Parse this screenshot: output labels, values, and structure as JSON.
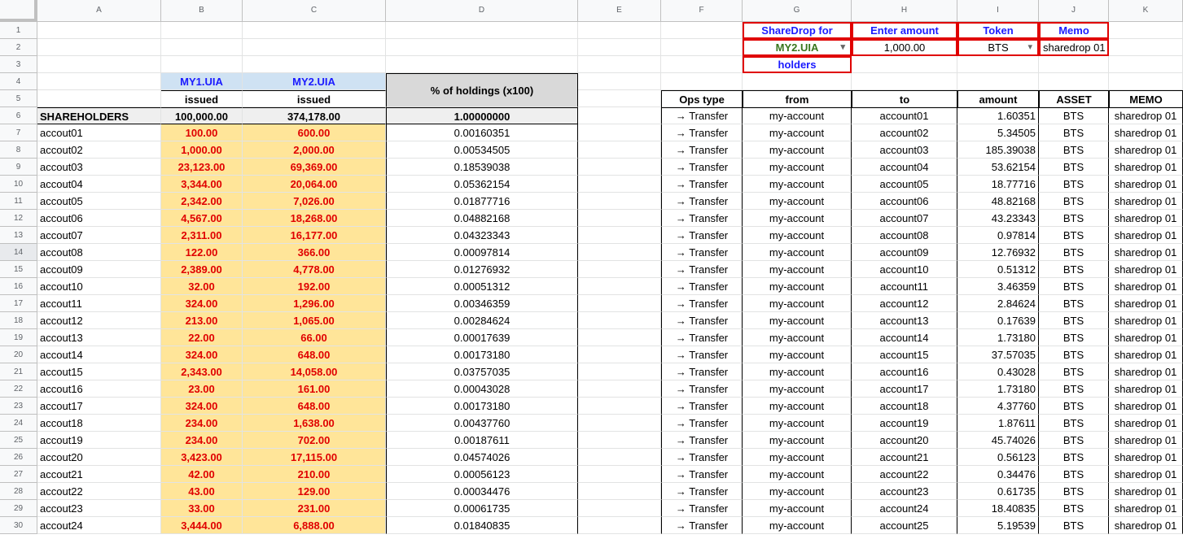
{
  "columns": [
    "A",
    "B",
    "C",
    "D",
    "E",
    "F",
    "G",
    "H",
    "I",
    "J",
    "K"
  ],
  "rows": [
    "1",
    "2",
    "3",
    "4",
    "5",
    "6",
    "7",
    "8",
    "9",
    "10",
    "11",
    "12",
    "13",
    "14",
    "15",
    "16",
    "17",
    "18",
    "19",
    "20",
    "21",
    "22",
    "23",
    "24",
    "25",
    "26",
    "27",
    "28",
    "29",
    "30"
  ],
  "left_table": {
    "asset_headers": [
      "MY1.UIA",
      "MY2.UIA"
    ],
    "issued_label": "issued",
    "pct_header": "% of holdings (x100)",
    "total_label": "SHAREHOLDERS",
    "totals": [
      "100,000.00",
      "374,178.00",
      "1.00000000"
    ],
    "rows": [
      [
        "accout01",
        "100.00",
        "600.00",
        "0.00160351"
      ],
      [
        "accout02",
        "1,000.00",
        "2,000.00",
        "0.00534505"
      ],
      [
        "accout03",
        "23,123.00",
        "69,369.00",
        "0.18539038"
      ],
      [
        "accout04",
        "3,344.00",
        "20,064.00",
        "0.05362154"
      ],
      [
        "accout05",
        "2,342.00",
        "7,026.00",
        "0.01877716"
      ],
      [
        "accout06",
        "4,567.00",
        "18,268.00",
        "0.04882168"
      ],
      [
        "accout07",
        "2,311.00",
        "16,177.00",
        "0.04323343"
      ],
      [
        "accout08",
        "122.00",
        "366.00",
        "0.00097814"
      ],
      [
        "accout09",
        "2,389.00",
        "4,778.00",
        "0.01276932"
      ],
      [
        "accout10",
        "32.00",
        "192.00",
        "0.00051312"
      ],
      [
        "accout11",
        "324.00",
        "1,296.00",
        "0.00346359"
      ],
      [
        "accout12",
        "213.00",
        "1,065.00",
        "0.00284624"
      ],
      [
        "accout13",
        "22.00",
        "66.00",
        "0.00017639"
      ],
      [
        "accout14",
        "324.00",
        "648.00",
        "0.00173180"
      ],
      [
        "accout15",
        "2,343.00",
        "14,058.00",
        "0.03757035"
      ],
      [
        "accout16",
        "23.00",
        "161.00",
        "0.00043028"
      ],
      [
        "accout17",
        "324.00",
        "648.00",
        "0.00173180"
      ],
      [
        "accout18",
        "234.00",
        "1,638.00",
        "0.00437760"
      ],
      [
        "accout19",
        "234.00",
        "702.00",
        "0.00187611"
      ],
      [
        "accout20",
        "3,423.00",
        "17,115.00",
        "0.04574026"
      ],
      [
        "accout21",
        "42.00",
        "210.00",
        "0.00056123"
      ],
      [
        "accout22",
        "43.00",
        "129.00",
        "0.00034476"
      ],
      [
        "accout23",
        "33.00",
        "231.00",
        "0.00061735"
      ],
      [
        "accout24",
        "3,444.00",
        "6,888.00",
        "0.01840835"
      ]
    ]
  },
  "controls": {
    "sharedrop_label": "ShareDrop for",
    "sharedrop_value": "MY2.UIA",
    "holders_label": "holders",
    "amount_label": "Enter amount",
    "amount_value": "1,000.00",
    "token_label": "Token",
    "token_value": "BTS",
    "memo_label": "Memo",
    "memo_value": "sharedrop 01"
  },
  "ops_table": {
    "headers": [
      "Ops type",
      "from",
      "to",
      "amount",
      "ASSET",
      "MEMO"
    ],
    "rows": [
      [
        "→ Transfer",
        "my-account",
        "account01",
        "1.60351",
        "BTS",
        "sharedrop 01"
      ],
      [
        "→ Transfer",
        "my-account",
        "account02",
        "5.34505",
        "BTS",
        "sharedrop 01"
      ],
      [
        "→ Transfer",
        "my-account",
        "account03",
        "185.39038",
        "BTS",
        "sharedrop 01"
      ],
      [
        "→ Transfer",
        "my-account",
        "account04",
        "53.62154",
        "BTS",
        "sharedrop 01"
      ],
      [
        "→ Transfer",
        "my-account",
        "account05",
        "18.77716",
        "BTS",
        "sharedrop 01"
      ],
      [
        "→ Transfer",
        "my-account",
        "account06",
        "48.82168",
        "BTS",
        "sharedrop 01"
      ],
      [
        "→ Transfer",
        "my-account",
        "account07",
        "43.23343",
        "BTS",
        "sharedrop 01"
      ],
      [
        "→ Transfer",
        "my-account",
        "account08",
        "0.97814",
        "BTS",
        "sharedrop 01"
      ],
      [
        "→ Transfer",
        "my-account",
        "account09",
        "12.76932",
        "BTS",
        "sharedrop 01"
      ],
      [
        "→ Transfer",
        "my-account",
        "account10",
        "0.51312",
        "BTS",
        "sharedrop 01"
      ],
      [
        "→ Transfer",
        "my-account",
        "account11",
        "3.46359",
        "BTS",
        "sharedrop 01"
      ],
      [
        "→ Transfer",
        "my-account",
        "account12",
        "2.84624",
        "BTS",
        "sharedrop 01"
      ],
      [
        "→ Transfer",
        "my-account",
        "account13",
        "0.17639",
        "BTS",
        "sharedrop 01"
      ],
      [
        "→ Transfer",
        "my-account",
        "account14",
        "1.73180",
        "BTS",
        "sharedrop 01"
      ],
      [
        "→ Transfer",
        "my-account",
        "account15",
        "37.57035",
        "BTS",
        "sharedrop 01"
      ],
      [
        "→ Transfer",
        "my-account",
        "account16",
        "0.43028",
        "BTS",
        "sharedrop 01"
      ],
      [
        "→ Transfer",
        "my-account",
        "account17",
        "1.73180",
        "BTS",
        "sharedrop 01"
      ],
      [
        "→ Transfer",
        "my-account",
        "account18",
        "4.37760",
        "BTS",
        "sharedrop 01"
      ],
      [
        "→ Transfer",
        "my-account",
        "account19",
        "1.87611",
        "BTS",
        "sharedrop 01"
      ],
      [
        "→ Transfer",
        "my-account",
        "account20",
        "45.74026",
        "BTS",
        "sharedrop 01"
      ],
      [
        "→ Transfer",
        "my-account",
        "account21",
        "0.56123",
        "BTS",
        "sharedrop 01"
      ],
      [
        "→ Transfer",
        "my-account",
        "account22",
        "0.34476",
        "BTS",
        "sharedrop 01"
      ],
      [
        "→ Transfer",
        "my-account",
        "account23",
        "0.61735",
        "BTS",
        "sharedrop 01"
      ],
      [
        "→ Transfer",
        "my-account",
        "account24",
        "18.40835",
        "BTS",
        "sharedrop 01"
      ],
      [
        "→ Transfer",
        "my-account",
        "account25",
        "5.19539",
        "BTS",
        "sharedrop 01"
      ]
    ]
  }
}
